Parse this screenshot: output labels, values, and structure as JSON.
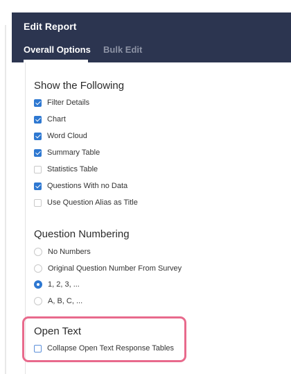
{
  "header": {
    "title": "Edit Report",
    "tabs": [
      {
        "label": "Overall Options",
        "active": true
      },
      {
        "label": "Bulk Edit",
        "active": false
      }
    ]
  },
  "show": {
    "title": "Show the Following",
    "options": [
      {
        "label": "Filter Details",
        "checked": true
      },
      {
        "label": "Chart",
        "checked": true
      },
      {
        "label": "Word Cloud",
        "checked": true
      },
      {
        "label": "Summary Table",
        "checked": true
      },
      {
        "label": "Statistics Table",
        "checked": false
      },
      {
        "label": "Questions With no Data",
        "checked": true
      },
      {
        "label": "Use Question Alias as Title",
        "checked": false
      }
    ]
  },
  "numbering": {
    "title": "Question Numbering",
    "options": [
      {
        "label": "No Numbers",
        "selected": false
      },
      {
        "label": "Original Question Number From Survey",
        "selected": false
      },
      {
        "label": "1, 2, 3, ...",
        "selected": true
      },
      {
        "label": "A, B, C, ...",
        "selected": false
      }
    ]
  },
  "open_text": {
    "title": "Open Text",
    "options": [
      {
        "label": "Collapse Open Text Response Tables",
        "checked": false
      }
    ]
  },
  "colors": {
    "header_bg": "#2c3550",
    "accent": "#2e78d1",
    "highlight": "#e86a8c"
  }
}
